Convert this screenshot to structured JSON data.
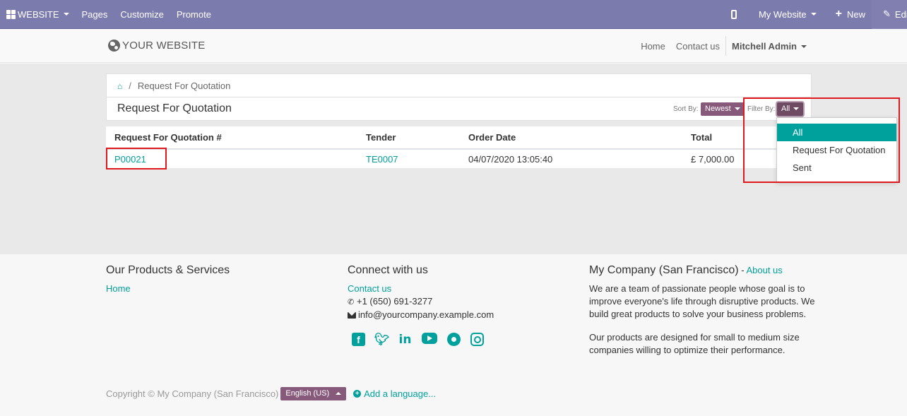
{
  "admin_bar": {
    "website_menu": "WEBSITE",
    "pages": "Pages",
    "customize": "Customize",
    "promote": "Promote",
    "my_website": "My Website",
    "new": "New",
    "edit": "Edit"
  },
  "header": {
    "logo_text": "YOUR WEBSITE",
    "nav": [
      "Home",
      "Contact us"
    ],
    "user": "Mitchell Admin"
  },
  "breadcrumb": {
    "current": "Request For Quotation"
  },
  "page": {
    "title": "Request For Quotation",
    "sort_label": "Sort By:",
    "sort_value": "Newest",
    "filter_label": "Filter By:",
    "filter_value": "All"
  },
  "table": {
    "headers": [
      "Request For Quotation #",
      "Tender",
      "Order Date",
      "Total"
    ],
    "rows": [
      {
        "number": "P00021",
        "tender": "TE0007",
        "order_date": "04/07/2020 13:05:40",
        "total": "£ 7,000.00"
      }
    ]
  },
  "filter_dropdown": {
    "options": [
      "All",
      "Request For Quotation",
      "Sent"
    ],
    "active": "All"
  },
  "footer": {
    "col1_title": "Our Products & Services",
    "col1_link": "Home",
    "col2_title": "Connect with us",
    "contact_link": "Contact us",
    "phone": "+1 (650) 691-3277",
    "email": "info@yourcompany.example.com",
    "col3_title": "My Company (San Francisco)",
    "col3_sep": " - ",
    "about_link": "About us",
    "para1": "We are a team of passionate people whose goal is to improve everyone's life through disruptive products. We build great products to solve your business problems.",
    "para2": "Our products are designed for small to medium size companies willing to optimize their performance.",
    "copyright": "Copyright © My Company (San Francisco)",
    "language": "English (US)",
    "add_language": "Add a language..."
  },
  "colors": {
    "admin_bar": "#7c7bad",
    "accent": "#00a09d",
    "button_purple": "#875a7b",
    "highlight_red": "#e0191f"
  },
  "icons": [
    "apps-grid-icon",
    "mobile-icon",
    "plus-icon",
    "pencil-icon",
    "globe-icon",
    "home-icon",
    "phone-icon",
    "envelope-icon",
    "facebook-icon",
    "twitter-icon",
    "linkedin-icon",
    "youtube-icon",
    "github-icon",
    "instagram-icon",
    "plus-circle-icon"
  ]
}
